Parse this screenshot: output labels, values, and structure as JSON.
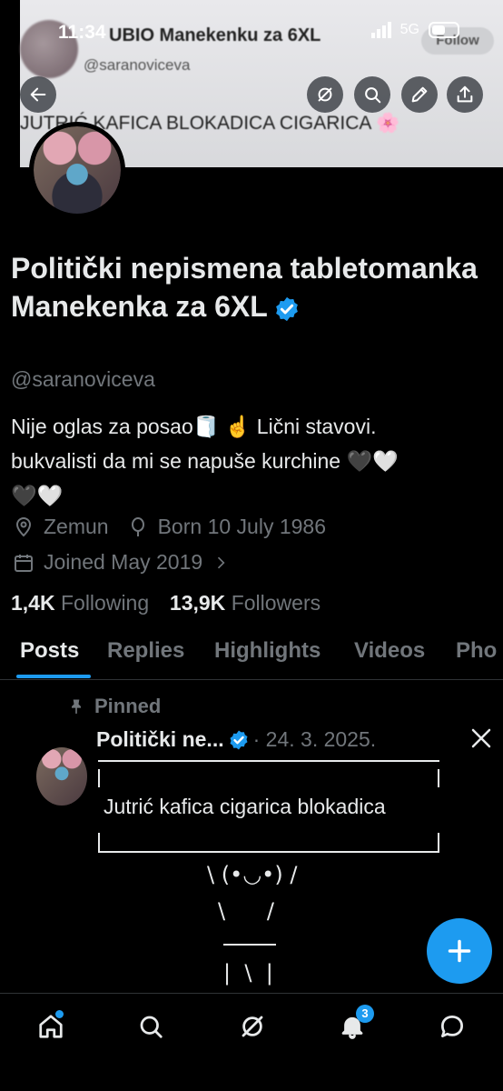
{
  "status_bar": {
    "time": "11:34",
    "network": "5G"
  },
  "banner": {
    "title": "UBIO Manekenku za 6XL",
    "handle": "@saranoviceva",
    "follow_label": "Follow",
    "tweet_text": "JUTRIĆ KAFICA BLOKADICA CIGARICA 🌸"
  },
  "profile": {
    "display_name": "Politički nepismena tabletomanka Manekenka za 6XL",
    "handle": "@saranoviceva",
    "bio_line1": "Nije oglas za posao🧻 ☝️ Lični stavovi.",
    "bio_line2": "bukvalisti da mi se napuše kurchine 🖤🤍",
    "bio_line3": "🖤🤍",
    "location": "Zemun",
    "born": "Born 10 July 1986",
    "joined": "Joined May 2019",
    "following_count": "1,4K",
    "following_label": "Following",
    "followers_count": "13,9K",
    "followers_label": "Followers"
  },
  "tabs": [
    {
      "label": "Posts",
      "active": true
    },
    {
      "label": "Replies"
    },
    {
      "label": "Highlights"
    },
    {
      "label": "Videos"
    },
    {
      "label": "Pho"
    }
  ],
  "pinned_post": {
    "pinned_label": "Pinned",
    "author": "Politički ne...",
    "date": "· 24. 3. 2025.",
    "text": "Jutrić kafica cigarica blokadica",
    "kaomoji": "\\ (•◡•) /",
    "arms": "\\      /",
    "legs": "|  \\  |"
  },
  "bottom_nav": {
    "notifications_badge": "3"
  },
  "colors": {
    "accent": "#1d9bf0",
    "muted": "#71767b",
    "text": "#e7e9ea",
    "background": "#000000"
  }
}
